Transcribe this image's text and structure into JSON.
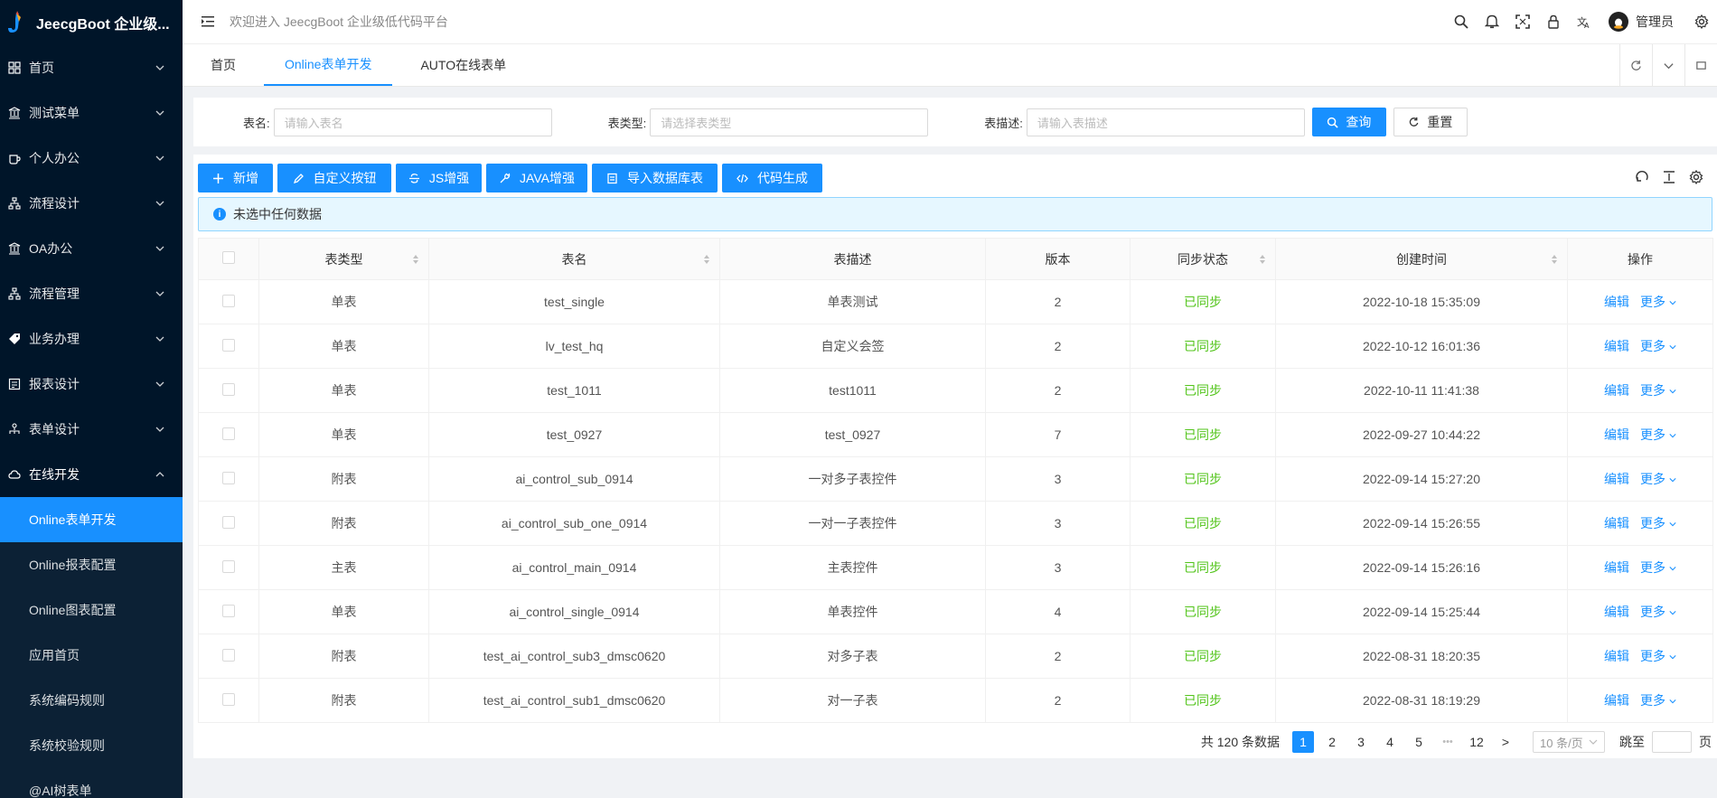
{
  "app": {
    "title": "JeecgBoot 企业级...",
    "welcome": "欢迎进入 JeecgBoot 企业级低代码平台",
    "username": "管理员"
  },
  "sidebar": {
    "items": [
      {
        "label": "首页",
        "icon": "dashboard-icon"
      },
      {
        "label": "测试菜单",
        "icon": "bank-icon"
      },
      {
        "label": "个人办公",
        "icon": "coffee-icon"
      },
      {
        "label": "流程设计",
        "icon": "flow-icon"
      },
      {
        "label": "OA办公",
        "icon": "bank-icon"
      },
      {
        "label": "流程管理",
        "icon": "flow-icon"
      },
      {
        "label": "业务办理",
        "icon": "tag-icon"
      },
      {
        "label": "报表设计",
        "icon": "report-icon"
      },
      {
        "label": "表单设计",
        "icon": "cluster-icon"
      },
      {
        "label": "在线开发",
        "icon": "cloud-icon"
      }
    ],
    "subitems": [
      {
        "label": "Online表单开发"
      },
      {
        "label": "Online报表配置"
      },
      {
        "label": "Online图表配置"
      },
      {
        "label": "应用首页"
      },
      {
        "label": "系统编码规则"
      },
      {
        "label": "系统校验规则"
      },
      {
        "label": "@AI树表单"
      }
    ]
  },
  "tabs": [
    {
      "label": "首页"
    },
    {
      "label": "Online表单开发"
    },
    {
      "label": "AUTO在线表单"
    }
  ],
  "search": {
    "name_label": "表名:",
    "name_placeholder": "请输入表名",
    "type_label": "表类型:",
    "type_placeholder": "请选择表类型",
    "desc_label": "表描述:",
    "desc_placeholder": "请输入表描述",
    "query": "查询",
    "reset": "重置"
  },
  "toolbar": {
    "add": "新增",
    "custom_btn": "自定义按钮",
    "js": "JS增强",
    "java": "JAVA增强",
    "import_db": "导入数据库表",
    "codegen": "代码生成"
  },
  "alert": "未选中任何数据",
  "table": {
    "headers": [
      "表类型",
      "表名",
      "表描述",
      "版本",
      "同步状态",
      "创建时间",
      "操作"
    ],
    "rows": [
      {
        "type": "单表",
        "name": "test_single",
        "desc": "单表测试",
        "version": "2",
        "status": "已同步",
        "created": "2022-10-18 15:35:09"
      },
      {
        "type": "单表",
        "name": "lv_test_hq",
        "desc": "自定义会签",
        "version": "2",
        "status": "已同步",
        "created": "2022-10-12 16:01:36"
      },
      {
        "type": "单表",
        "name": "test_1011",
        "desc": "test1011",
        "version": "2",
        "status": "已同步",
        "created": "2022-10-11 11:41:38"
      },
      {
        "type": "单表",
        "name": "test_0927",
        "desc": "test_0927",
        "version": "7",
        "status": "已同步",
        "created": "2022-09-27 10:44:22"
      },
      {
        "type": "附表",
        "name": "ai_control_sub_0914",
        "desc": "一对多子表控件",
        "version": "3",
        "status": "已同步",
        "created": "2022-09-14 15:27:20"
      },
      {
        "type": "附表",
        "name": "ai_control_sub_one_0914",
        "desc": "一对一子表控件",
        "version": "3",
        "status": "已同步",
        "created": "2022-09-14 15:26:55"
      },
      {
        "type": "主表",
        "name": "ai_control_main_0914",
        "desc": "主表控件",
        "version": "3",
        "status": "已同步",
        "created": "2022-09-14 15:26:16"
      },
      {
        "type": "单表",
        "name": "ai_control_single_0914",
        "desc": "单表控件",
        "version": "4",
        "status": "已同步",
        "created": "2022-09-14 15:25:44"
      },
      {
        "type": "附表",
        "name": "test_ai_control_sub3_dmsc0620",
        "desc": "对多子表",
        "version": "2",
        "status": "已同步",
        "created": "2022-08-31 18:20:35"
      },
      {
        "type": "附表",
        "name": "test_ai_control_sub1_dmsc0620",
        "desc": "对一子表",
        "version": "2",
        "status": "已同步",
        "created": "2022-08-31 18:19:29"
      }
    ],
    "edit": "编辑",
    "more": "更多"
  },
  "pagination": {
    "total": "共 120 条数据",
    "pages": [
      "1",
      "2",
      "3",
      "4",
      "5"
    ],
    "ellipsis": "•••",
    "last": "12",
    "next": ">",
    "size": "10 条/页",
    "jump": "跳至",
    "page_unit": "页"
  },
  "colors": {
    "primary": "#1890ff",
    "sidebar": "#001529",
    "success": "#52c41a"
  }
}
